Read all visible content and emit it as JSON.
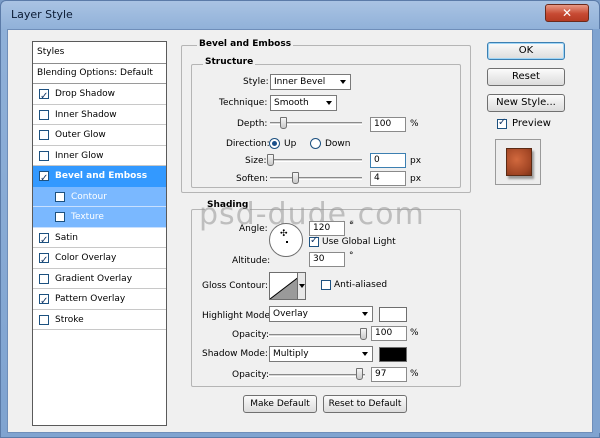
{
  "window": {
    "title": "Layer Style",
    "close_glyph": "✕"
  },
  "styles_panel": {
    "header": "Styles",
    "blending_options": "Blending Options: Default",
    "items": [
      {
        "label": "Drop Shadow",
        "checked": true
      },
      {
        "label": "Inner Shadow",
        "checked": false
      },
      {
        "label": "Outer Glow",
        "checked": false
      },
      {
        "label": "Inner Glow",
        "checked": false
      },
      {
        "label": "Bevel and Emboss",
        "checked": true,
        "active": true
      },
      {
        "label": "Contour",
        "checked": false,
        "sub": true
      },
      {
        "label": "Texture",
        "checked": false,
        "sub": true
      },
      {
        "label": "Satin",
        "checked": true
      },
      {
        "label": "Color Overlay",
        "checked": true
      },
      {
        "label": "Gradient Overlay",
        "checked": false
      },
      {
        "label": "Pattern Overlay",
        "checked": true
      },
      {
        "label": "Stroke",
        "checked": false
      }
    ]
  },
  "bevel": {
    "group_title": "Bevel and Emboss",
    "structure_title": "Structure",
    "style_label": "Style:",
    "style_value": "Inner Bevel",
    "technique_label": "Technique:",
    "technique_value": "Smooth",
    "depth_label": "Depth:",
    "depth_value": "100",
    "depth_unit": "%",
    "direction_label": "Direction:",
    "direction_up": "Up",
    "direction_down": "Down",
    "size_label": "Size:",
    "size_value": "0",
    "size_unit": "px",
    "soften_label": "Soften:",
    "soften_value": "4",
    "soften_unit": "px"
  },
  "shading": {
    "title": "Shading",
    "angle_label": "Angle:",
    "angle_value": "120",
    "angle_unit": "°",
    "use_global_light": "Use Global Light",
    "altitude_label": "Altitude:",
    "altitude_value": "30",
    "altitude_unit": "°",
    "gloss_contour_label": "Gloss Contour:",
    "anti_aliased": "Anti-aliased",
    "highlight_mode_label": "Highlight Mode:",
    "highlight_mode_value": "Overlay",
    "highlight_color": "#ffffff",
    "highlight_opacity_label": "Opacity:",
    "highlight_opacity_value": "100",
    "highlight_opacity_unit": "%",
    "shadow_mode_label": "Shadow Mode:",
    "shadow_mode_value": "Multiply",
    "shadow_color": "#000000",
    "shadow_opacity_label": "Opacity:",
    "shadow_opacity_value": "97",
    "shadow_opacity_unit": "%"
  },
  "buttons": {
    "ok": "OK",
    "reset": "Reset",
    "new_style": "New Style...",
    "preview": "Preview",
    "make_default": "Make Default",
    "reset_to_default": "Reset to Default"
  },
  "watermark": "psd-dude.com"
}
